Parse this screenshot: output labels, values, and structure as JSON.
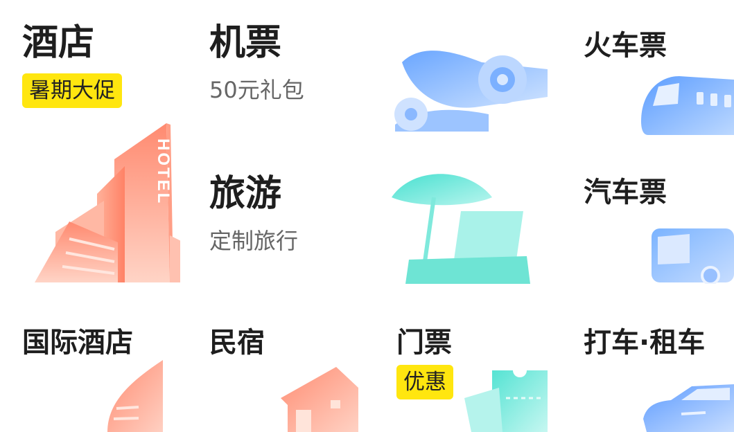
{
  "tiles": {
    "hotel": {
      "title": "酒店",
      "badge": "暑期大促",
      "art_text": "HOTEL"
    },
    "flight": {
      "title": "机票",
      "subtitle": "50元礼包"
    },
    "train": {
      "title": "火车票"
    },
    "travel": {
      "title": "旅游",
      "subtitle": "定制旅行"
    },
    "bus": {
      "title": "汽车票"
    },
    "intl_hotel": {
      "title": "国际酒店"
    },
    "homestay": {
      "title": "民宿"
    },
    "tickets": {
      "title": "门票",
      "badge": "优惠"
    },
    "taxi": {
      "title": "打车·租车"
    }
  },
  "colors": {
    "badge": "#ffe60f",
    "hotel_art": "#ff9a80",
    "transport_art": "#7eb0ff",
    "travel_art": "#6fe6d8"
  },
  "icons": [
    "hotel-building-icon",
    "airplane-icon",
    "train-icon",
    "beach-umbrella-chair-icon",
    "bus-icon",
    "intl-hotel-icon",
    "house-icon",
    "ticket-icon",
    "car-icon"
  ]
}
